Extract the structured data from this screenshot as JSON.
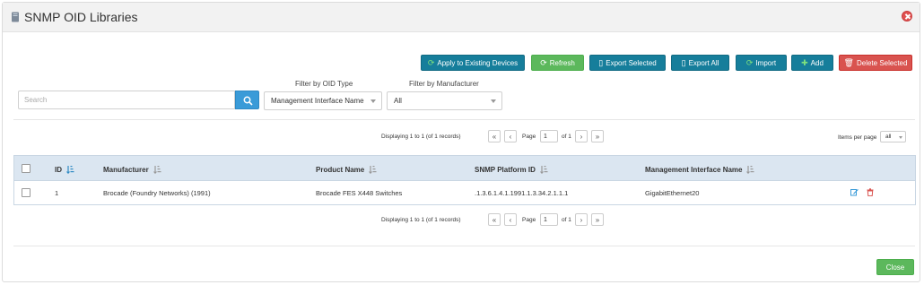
{
  "header": {
    "title": "SNMP OID Libraries"
  },
  "toolbar": {
    "apply_label": "Apply to Existing Devices",
    "refresh_label": "Refresh",
    "export_selected_label": "Export Selected",
    "export_all_label": "Export All",
    "import_label": "Import",
    "add_label": "Add",
    "delete_selected_label": "Delete Selected"
  },
  "search": {
    "placeholder": "Search",
    "value": ""
  },
  "filters": {
    "oid_type": {
      "label": "Filter by OID Type",
      "selected": "Management Interface Name"
    },
    "manufacturer": {
      "label": "Filter by Manufacturer",
      "selected": "All"
    }
  },
  "pagination": {
    "display_text": "Displaying 1 to 1 (of 1 records)",
    "page_label": "Page",
    "page_value": "1",
    "of_label": "of 1",
    "first": "«",
    "prev": "‹",
    "next": "›",
    "last": "»",
    "items_per_page_label": "Items per page",
    "items_per_page_value": "all"
  },
  "table": {
    "columns": [
      "ID",
      "Manufacturer",
      "Product Name",
      "SNMP Platform ID",
      "Management Interface Name"
    ],
    "rows": [
      {
        "id": "1",
        "manufacturer": "Brocade (Foundry Networks) (1991)",
        "product_name": "Brocade FES X448 Switches",
        "snmp_platform_id": ".1.3.6.1.4.1.1991.1.3.34.2.1.1.1",
        "management_interface_name": "GigabitEthernet20"
      }
    ]
  },
  "footer": {
    "close_label": "Close"
  },
  "colors": {
    "header_bg": "#f2f2f2",
    "primary_teal": "#167e9b",
    "success_green": "#5cb85c",
    "danger_red": "#d9534f",
    "table_header_bg": "#dbe6f1",
    "search_blue": "#3a9bd8"
  }
}
